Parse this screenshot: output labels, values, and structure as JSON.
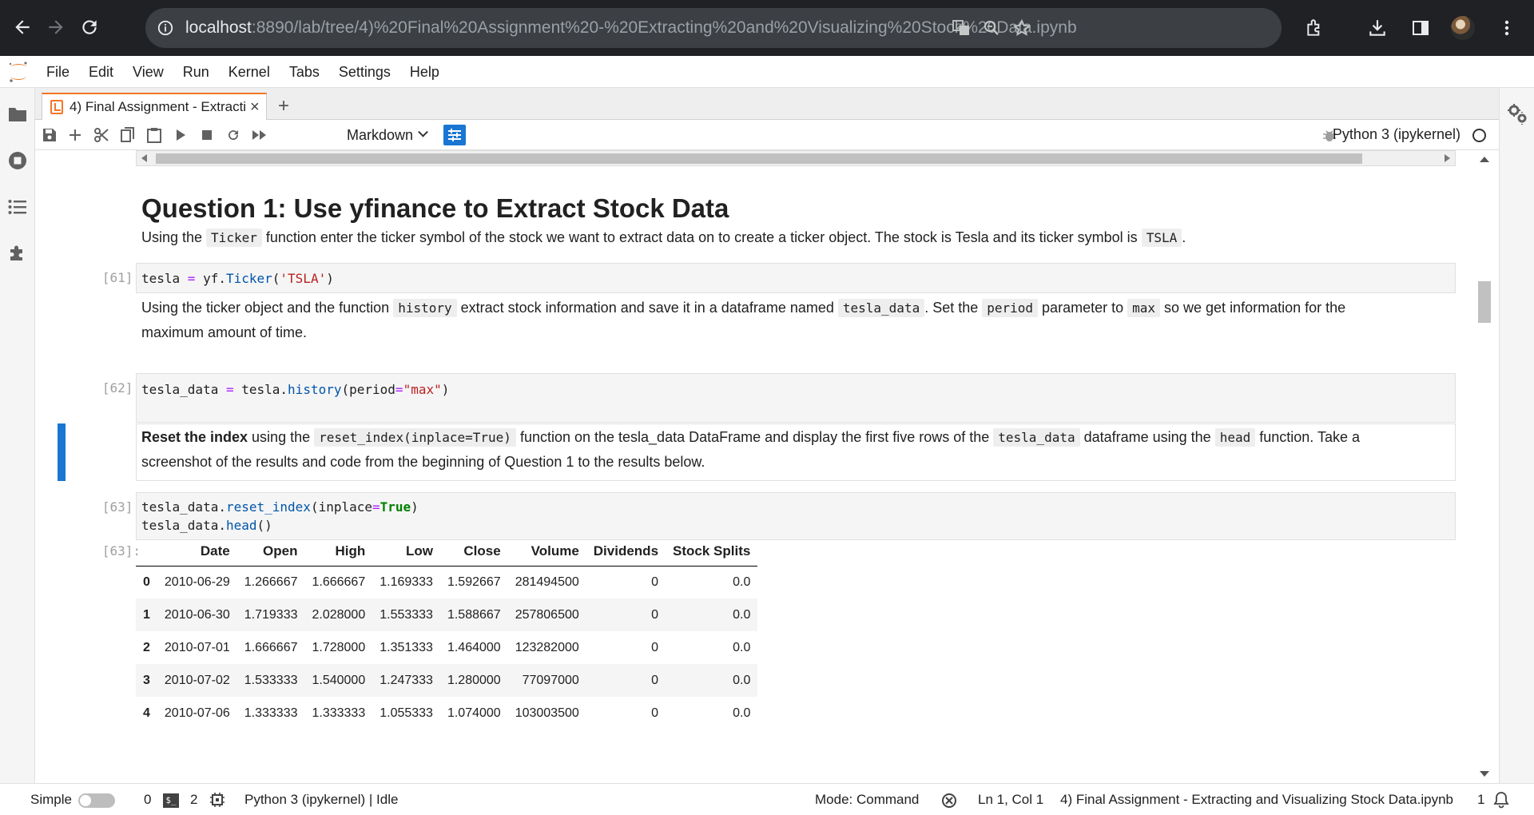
{
  "browser": {
    "url_host": "localhost",
    "url_rest": ":8890/lab/tree/4)%20Final%20Assignment%20-%20Extracting%20and%20Visualizing%20Stock%20Data.ipynb"
  },
  "menubar": {
    "items": [
      "File",
      "Edit",
      "View",
      "Run",
      "Kernel",
      "Tabs",
      "Settings",
      "Help"
    ]
  },
  "tab": {
    "label": "4) Final Assignment - Extracti",
    "close": "×",
    "add": "+"
  },
  "toolbar": {
    "cell_type": "Markdown",
    "kernel": "Python 3 (ipykernel)"
  },
  "notebook": {
    "heading": "Question 1: Use yfinance to Extract Stock Data",
    "md1": {
      "t1": "Using the ",
      "c1": "Ticker",
      "t2": " function enter the ticker symbol of the stock we want to extract data on to create a ticker object. The stock is Tesla and its ticker symbol is ",
      "c2": "TSLA",
      "t3": "."
    },
    "cell61": {
      "prompt": "[61]:",
      "a": "tesla ",
      "eq": "=",
      "b": " yf.",
      "fn": "Ticker",
      "c": "(",
      "str": "'TSLA'",
      "d": ")"
    },
    "md2": {
      "t1": "Using the ticker object and the function ",
      "c1": "history",
      "t2": " extract stock information and save it in a dataframe named ",
      "c2": "tesla_data",
      "t3": ". Set the ",
      "c3": "period",
      "t4": " parameter to ",
      "c4": "max",
      "t5": " so we get information for the",
      "line2": "maximum amount of time."
    },
    "cell62": {
      "prompt": "[62]:",
      "a": "tesla_data ",
      "eq": "=",
      "b": " tesla.",
      "fn": "history",
      "c": "(period",
      "eq2": "=",
      "str": "\"max\"",
      "d": ")"
    },
    "md3": {
      "bold": "Reset the index",
      "t1": " using the ",
      "c1": "reset_index(inplace=True)",
      "t2": " function on the tesla_data DataFrame and display the first five rows of the ",
      "c2": "tesla_data",
      "t3": " dataframe using the ",
      "c3": "head",
      "t4": " function. Take a",
      "line2": "screenshot of the results and code from the beginning of Question 1 to the results below."
    },
    "cell63": {
      "prompt": "[63]:",
      "l1a": "tesla_data.",
      "l1fn": "reset_index",
      "l1b": "(inplace",
      "l1eq": "=",
      "l1kw": "True",
      "l1c": ")",
      "l2a": "tesla_data.",
      "l2fn": "head",
      "l2b": "()"
    },
    "out63": {
      "prompt": "[63]:",
      "columns": [
        "",
        "Date",
        "Open",
        "High",
        "Low",
        "Close",
        "Volume",
        "Dividends",
        "Stock Splits"
      ],
      "rows": [
        [
          "0",
          "2010-06-29",
          "1.266667",
          "1.666667",
          "1.169333",
          "1.592667",
          "281494500",
          "0",
          "0.0"
        ],
        [
          "1",
          "2010-06-30",
          "1.719333",
          "2.028000",
          "1.553333",
          "1.588667",
          "257806500",
          "0",
          "0.0"
        ],
        [
          "2",
          "2010-07-01",
          "1.666667",
          "1.728000",
          "1.351333",
          "1.464000",
          "123282000",
          "0",
          "0.0"
        ],
        [
          "3",
          "2010-07-02",
          "1.533333",
          "1.540000",
          "1.247333",
          "1.280000",
          "77097000",
          "0",
          "0.0"
        ],
        [
          "4",
          "2010-07-06",
          "1.333333",
          "1.333333",
          "1.055333",
          "1.074000",
          "103003500",
          "0",
          "0.0"
        ]
      ]
    }
  },
  "statusbar": {
    "simple": "Simple",
    "count0": "0",
    "term_glyph": "$_",
    "count2": "2",
    "kernel_status": "Python 3 (ipykernel) | Idle",
    "mode": "Mode: Command",
    "position": "Ln 1, Col 1",
    "filename": "4) Final Assignment - Extracting and Visualizing Stock Data.ipynb",
    "notif_count": "1"
  },
  "icons": [
    "back-icon",
    "forward-icon",
    "reload-icon",
    "site-info-icon",
    "translate-icon",
    "zoom-icon",
    "star-icon",
    "extensions-icon",
    "download-icon",
    "sidepanel-icon",
    "profile-avatar",
    "more-icon",
    "folder-icon",
    "running-icon",
    "toc-icon",
    "extension-manager-icon",
    "property-inspector-icon",
    "bug-icon",
    "bell-icon"
  ]
}
